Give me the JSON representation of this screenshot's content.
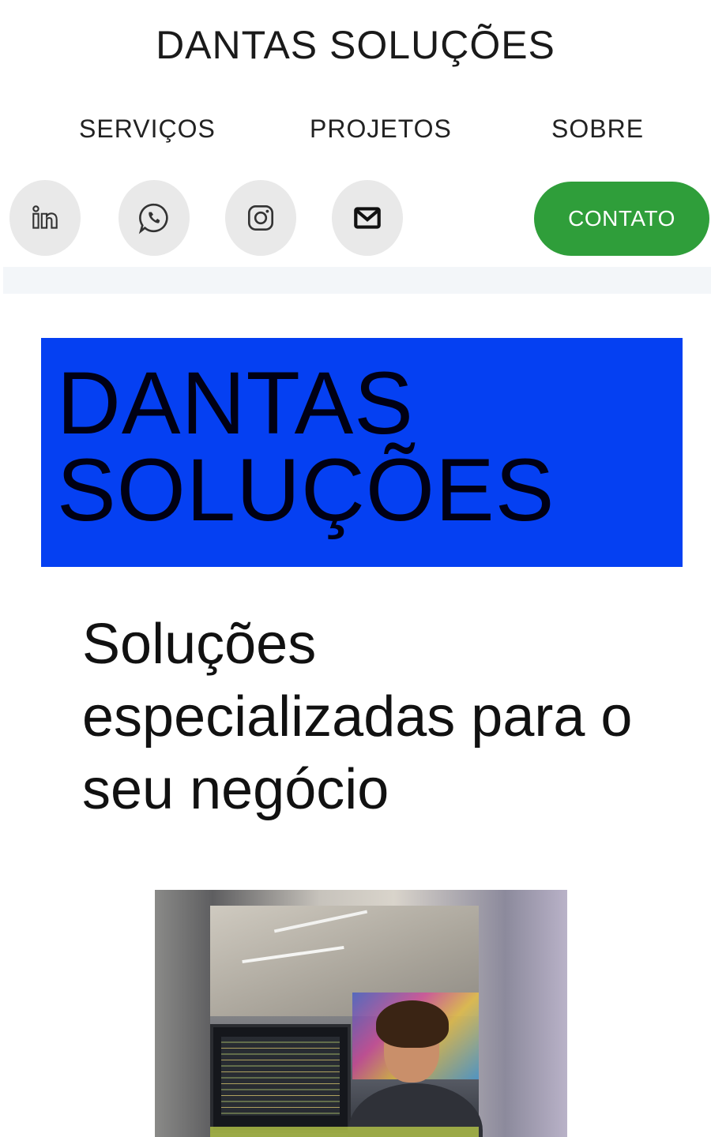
{
  "header": {
    "site_title": "DANTAS SOLUÇÕES"
  },
  "nav": {
    "items": [
      {
        "label": "SERVIÇOS"
      },
      {
        "label": "PROJETOS"
      },
      {
        "label": "SOBRE"
      }
    ]
  },
  "social": {
    "icons": [
      "linkedin-icon",
      "whatsapp-icon",
      "instagram-icon",
      "email-icon"
    ],
    "icon_background": "#e9e9e9"
  },
  "contact_button": {
    "label": "CONTATO",
    "color": "#2f9e3a"
  },
  "hero": {
    "title_line1": "DANTAS",
    "title_line2": "SOLUÇÕES",
    "box_color": "#0540f2",
    "tagline": "Soluções especializadas para o seu negócio"
  },
  "photo": {
    "icon": "profile-photo"
  }
}
